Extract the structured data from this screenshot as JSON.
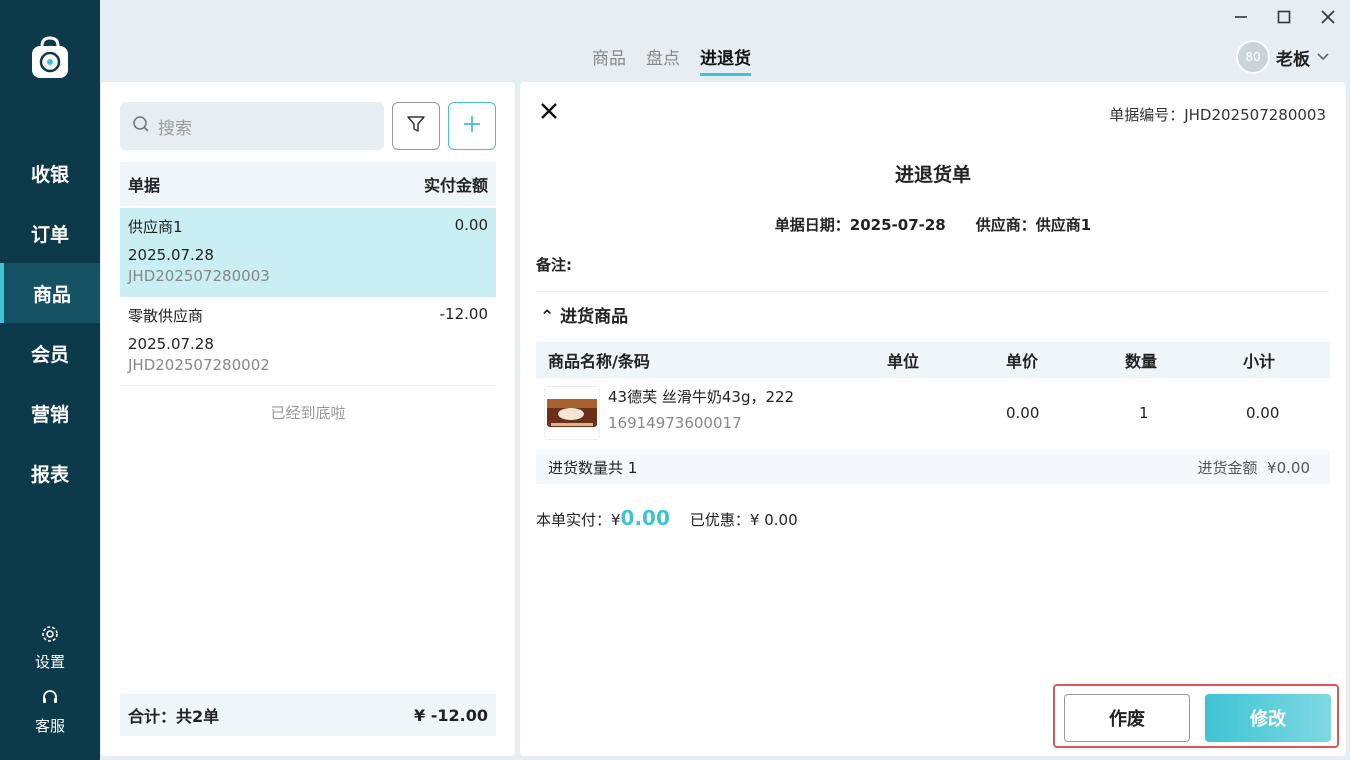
{
  "sidebar": {
    "items": [
      {
        "label": "收银"
      },
      {
        "label": "订单"
      },
      {
        "label": "商品"
      },
      {
        "label": "会员"
      },
      {
        "label": "营销"
      },
      {
        "label": "报表"
      }
    ],
    "active_index": 2,
    "settings_label": "设置",
    "support_label": "客服"
  },
  "topbar": {
    "tabs": [
      {
        "label": "商品"
      },
      {
        "label": "盘点"
      },
      {
        "label": "进退货"
      }
    ],
    "active_tab": 2,
    "user": {
      "avatar_text": "80",
      "name": "老板"
    }
  },
  "list_panel": {
    "search_placeholder": "搜索",
    "header": {
      "col1": "单据",
      "col2": "实付金额"
    },
    "rows": [
      {
        "supplier": "供应商1",
        "amount": "0.00",
        "date": "2025.07.28",
        "doc_no": "JHD202507280003",
        "selected": true
      },
      {
        "supplier": "零散供应商",
        "amount": "-12.00",
        "date": "2025.07.28",
        "doc_no": "JHD202507280002",
        "selected": false
      }
    ],
    "end_note": "已经到底啦",
    "total_label": "合计：共2单",
    "total_amount": "¥ -12.00"
  },
  "detail": {
    "doc_no": "单据编号：JHD202507280003",
    "title": "进退货单",
    "date": "单据日期：2025-07-28",
    "supplier": "供应商：供应商1",
    "remark": "备注:",
    "section_title": "⌃ 进货商品",
    "table_header": {
      "name": "商品名称/条码",
      "unit": "单位",
      "price": "单价",
      "qty": "数量",
      "subtotal": "小计"
    },
    "items": [
      {
        "name": "43德芙 丝滑牛奶43g，222",
        "barcode": "16914973600017",
        "unit": "",
        "price": "0.00",
        "qty": "1",
        "subtotal": "0.00"
      }
    ],
    "footer_qty": "进货数量共 1",
    "footer_amount": "进货金额  ¥0.00",
    "paid_label": "本单实付：¥",
    "paid_amount": "0.00",
    "discount": "已优惠：¥ 0.00",
    "void_button": "作废",
    "edit_button": "修改"
  },
  "colors": {
    "accent": "#3ec3d4",
    "sidebar": "#0d3a4a",
    "highlight": "#e05555"
  }
}
